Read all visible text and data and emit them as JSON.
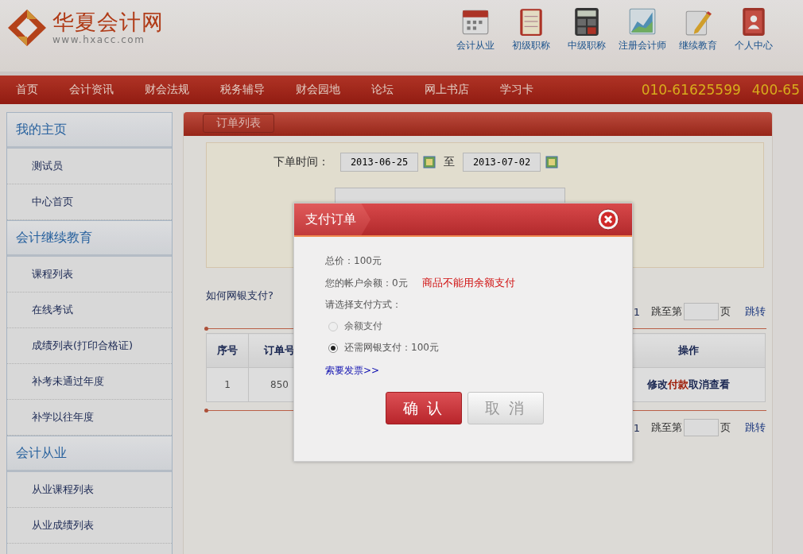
{
  "site": {
    "logo_text": "华夏会计网",
    "url": "www.hxacc.com"
  },
  "top_links": [
    {
      "label": "会计从业",
      "kind": "calendar"
    },
    {
      "label": "初级职称",
      "kind": "notebook"
    },
    {
      "label": "中级职称",
      "kind": "calculator"
    },
    {
      "label": "注册会计师",
      "kind": "chart"
    },
    {
      "label": "继续教育",
      "kind": "pencil"
    },
    {
      "label": "个人中心",
      "kind": "contacts"
    }
  ],
  "nav": {
    "items": [
      "首页",
      "会计资讯",
      "财会法规",
      "税务辅导",
      "财会园地",
      "论坛",
      "网上书店",
      "学习卡"
    ],
    "phones": [
      "010-61625599",
      "400-65"
    ]
  },
  "sidebar": [
    {
      "title": "我的主页",
      "items": [
        "测试员",
        "中心首页"
      ]
    },
    {
      "title": "会计继续教育",
      "items": [
        "课程列表",
        "在线考试",
        "成绩列表(打印合格证)",
        "补考未通过年度",
        "补学以往年度"
      ]
    },
    {
      "title": "会计从业",
      "items": [
        "从业课程列表",
        "从业成绩列表"
      ]
    }
  ],
  "panel": {
    "tab": "订单列表",
    "date_label": "下单时间：",
    "date_from": "2013-06-25",
    "to": "至",
    "date_to": "2013-07-02",
    "help_link": "如何网银支付?",
    "pagers": [
      {
        "page": "1",
        "jump_label": "跳至第",
        "page_unit": "页",
        "jump_button": "跳转"
      },
      {
        "page": "1",
        "jump_label": "跳至第",
        "page_unit": "页",
        "jump_button": "跳转"
      }
    ],
    "table": {
      "columns": [
        "序号",
        "订单号",
        "操作"
      ],
      "rows": [
        {
          "cells": [
            "1",
            "850"
          ],
          "actions": [
            {
              "label": "修改",
              "kind": "normal"
            },
            {
              "label": "付款",
              "kind": "highlight"
            },
            {
              "label": "取消",
              "kind": "normal"
            },
            {
              "label": "查看",
              "kind": "normal"
            }
          ]
        }
      ]
    }
  },
  "dialog": {
    "title": "支付订单",
    "total": "总价：100元",
    "balance": "您的帐户余额：0元",
    "warning": "商品不能用余额支付",
    "choose": "请选择支付方式：",
    "options": [
      {
        "label": "余额支付",
        "selected": false,
        "disabled": true
      },
      {
        "label": "还需网银支付：100元",
        "selected": true,
        "disabled": false
      }
    ],
    "invoice_link": "索要发票>>",
    "buttons": [
      {
        "label": "确 认",
        "kind": "primary"
      },
      {
        "label": "取 消",
        "kind": "secondary"
      }
    ]
  }
}
